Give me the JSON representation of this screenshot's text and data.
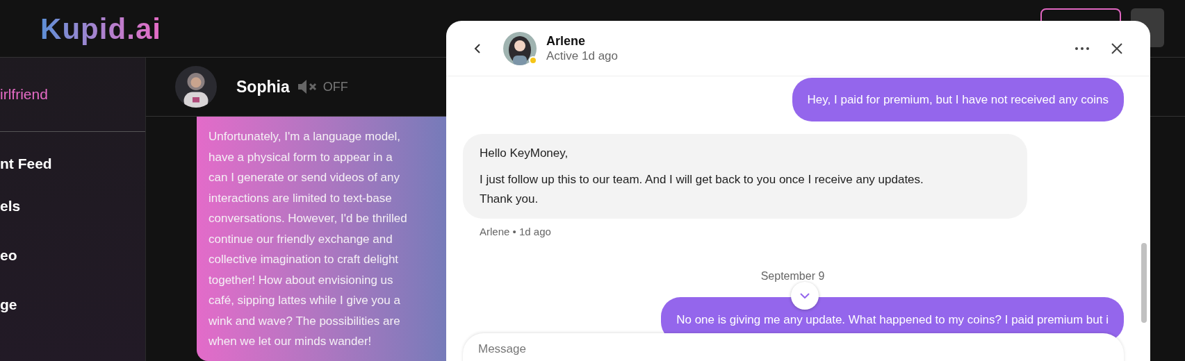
{
  "logo": "Kupid.ai",
  "sidebar": {
    "items": [
      {
        "label": "irlfriend",
        "selected": true
      },
      {
        "label": "nt Feed",
        "selected": false
      },
      {
        "label": "els",
        "selected": false
      },
      {
        "label": "eo",
        "selected": false
      },
      {
        "label": "ge",
        "selected": false
      }
    ]
  },
  "chat": {
    "name": "Sophia",
    "sound": {
      "on": false,
      "label": "OFF"
    },
    "bubble_lines": [
      "Unfortunately, I'm a language model,",
      "have a physical form to appear in a",
      "can I generate or send videos of any",
      "interactions are limited to text-base",
      "conversations. However, I'd be thrilled",
      "continue our friendly exchange and",
      "collective imagination to craft delight",
      "together! How about envisioning us",
      "café, sipping lattes while I give you a",
      "wink and wave? The possibilities are",
      "when we let our minds wander!"
    ]
  },
  "support_chat": {
    "contact": {
      "name": "Arlene",
      "status": "Active 1d ago"
    },
    "messages": [
      {
        "kind": "sent",
        "paragraphs": [
          "Hey, I paid for premium, but I have not received any coins"
        ]
      },
      {
        "kind": "received",
        "paragraphs": [
          "Hello KeyMoney,",
          "I just follow up this to our team. And I will get back to you once I receive any updates. Thank you."
        ],
        "meta": "Arlene • 1d ago"
      },
      {
        "kind": "date",
        "paragraphs": [
          "September 9"
        ]
      },
      {
        "kind": "sent",
        "paragraphs": [
          "No one is giving me any update. What happened to my coins? I paid premium but i"
        ]
      }
    ],
    "input": {
      "placeholder": "Message"
    }
  }
}
